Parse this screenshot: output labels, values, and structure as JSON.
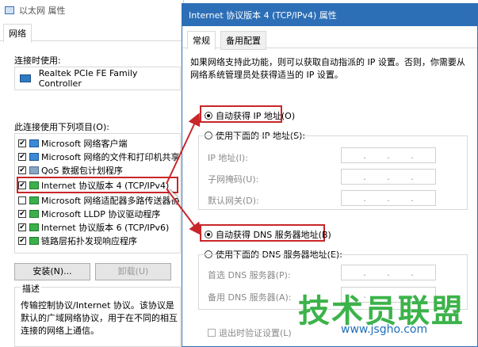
{
  "left_window": {
    "title": "以太网 属性",
    "tab": "网络",
    "connect_using_label": "连接时使用:",
    "adapter_name": "Realtek PCIe FE Family Controller",
    "items_label": "此连接使用下列项目(O):",
    "items": [
      {
        "label": "Microsoft 网络客户端",
        "checked": true,
        "icon": "network-client-icon"
      },
      {
        "label": "Microsoft 网络的文件和打印机共享",
        "checked": true,
        "icon": "file-share-icon"
      },
      {
        "label": "QoS 数据包计划程序",
        "checked": true,
        "icon": "qos-icon"
      },
      {
        "label": "Internet 协议版本 4 (TCP/IPv4)",
        "checked": true,
        "icon": "protocol-icon"
      },
      {
        "label": "Microsoft 网络适配器多路传送器协",
        "checked": false,
        "icon": "protocol-icon"
      },
      {
        "label": "Microsoft LLDP 协议驱动程序",
        "checked": true,
        "icon": "protocol-icon"
      },
      {
        "label": "Internet 协议版本 6 (TCP/IPv6)",
        "checked": true,
        "icon": "protocol-icon"
      },
      {
        "label": "链路层拓扑发现响应程序",
        "checked": true,
        "icon": "protocol-icon"
      }
    ],
    "install_button": "安装(N)...",
    "uninstall_button": "卸载(U)",
    "description_label": "描述",
    "description_text": "传输控制协议/Internet 协议。该协议是默认的广域网络协议，用于在不同的相互连接的网络上通信。"
  },
  "right_window": {
    "title": "Internet 协议版本 4 (TCP/IPv4) 属性",
    "tabs": [
      "常规",
      "备用配置"
    ],
    "description": "如果网络支持此功能，则可以获取自动指派的 IP 设置。否则，你需要从网络系统管理员处获得适当的 IP 设置。",
    "auto_ip": "自动获得 IP 地址(O)",
    "manual_ip": "使用下面的 IP 地址(S):",
    "ip_label": "IP 地址(I):",
    "mask_label": "子网掩码(U):",
    "gateway_label": "默认网关(D):",
    "auto_dns": "自动获得 DNS 服务器地址(B)",
    "manual_dns": "使用下面的 DNS 服务器地址(E):",
    "preferred_dns_label": "首选 DNS 服务器(P):",
    "alternate_dns_label": "备用 DNS 服务器(A):",
    "validate_label": "退出时验证设置(L)",
    "dots": "."
  },
  "watermark": {
    "main": "技术员联盟",
    "sub": "www.jsgho.com"
  },
  "colors": {
    "highlight": "#c8262a",
    "title_bar": "#2c6fb7"
  }
}
